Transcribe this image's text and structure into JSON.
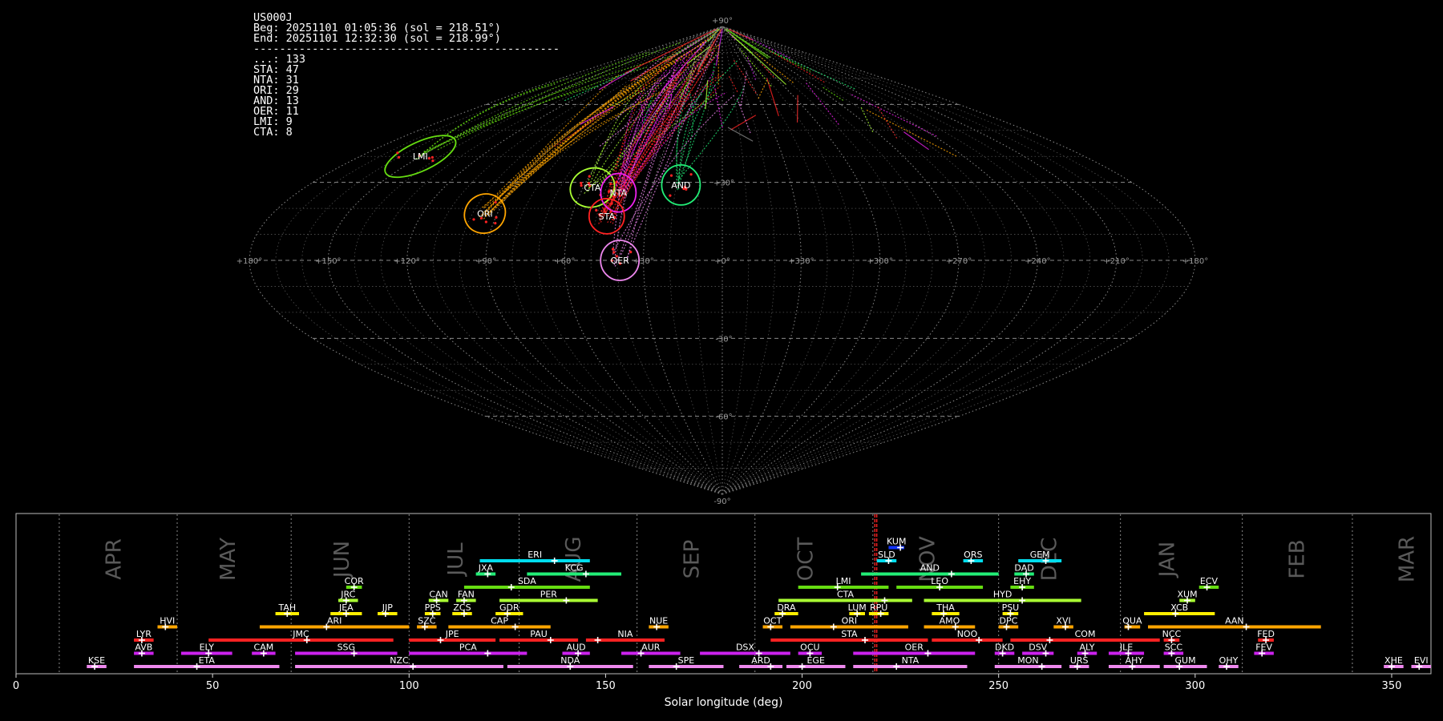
{
  "info": {
    "station": "US000J",
    "beg": "Beg: 20251101 01:05:36 (sol = 218.51°)",
    "end": "End: 20251101 12:32:30 (sol = 218.99°)",
    "separator": "-----------------------------------------------",
    "counts": [
      {
        "label": "...: 133"
      },
      {
        "label": "STA: 47"
      },
      {
        "label": "NTA: 31"
      },
      {
        "label": "ORI: 29"
      },
      {
        "label": "AND: 13"
      },
      {
        "label": "OER: 11"
      },
      {
        "label": "LMI: 9"
      },
      {
        "label": "CTA: 8"
      }
    ]
  },
  "chart_data": [
    {
      "type": "scatter",
      "projection": "sinusoidal",
      "grid": true,
      "lon_labels": [
        {
          "text": "+180°",
          "lon": 180
        },
        {
          "text": "+150°",
          "lon": 150
        },
        {
          "text": "+120°",
          "lon": 120
        },
        {
          "text": "+90°",
          "lon": 90
        },
        {
          "text": "+60°",
          "lon": 60
        },
        {
          "text": "+30°",
          "lon": 30
        },
        {
          "text": "+0°",
          "lon": 0
        },
        {
          "text": "+330°",
          "lon": -30
        },
        {
          "text": "+300°",
          "lon": -60
        },
        {
          "text": "+270°",
          "lon": -90
        },
        {
          "text": "+240°",
          "lon": -120
        },
        {
          "text": "+210°",
          "lon": -150
        },
        {
          "text": "+180°",
          "lon": -180
        }
      ],
      "lat_labels": [
        {
          "text": "+90°",
          "lat": 90
        },
        {
          "text": "+30°",
          "lat": 30
        },
        {
          "text": "-30°",
          "lat": -30
        },
        {
          "text": "-60°",
          "lat": -60
        },
        {
          "text": "-90°",
          "lat": -90
        }
      ],
      "radiants": [
        {
          "name": "LMI",
          "lon": 150,
          "lat": 40,
          "color": "#66dd11",
          "rx": 48,
          "ry": 18,
          "rot": -25
        },
        {
          "name": "ORI",
          "lon": 95,
          "lat": 18,
          "color": "#ffa500",
          "rx": 26,
          "ry": 24,
          "rot": -30
        },
        {
          "name": "CTA",
          "lon": 56,
          "lat": 28,
          "color": "#aaff33",
          "rx": 28,
          "ry": 24,
          "rot": -20
        },
        {
          "name": "NTA",
          "lon": 44,
          "lat": 26,
          "color": "#ee22ee",
          "rx": 22,
          "ry": 24,
          "rot": 0
        },
        {
          "name": "STA",
          "lon": 46,
          "lat": 17,
          "color": "#ff2222",
          "rx": 22,
          "ry": 22,
          "rot": 0
        },
        {
          "name": "AND",
          "lon": 18,
          "lat": 29,
          "color": "#22ee77",
          "rx": 24,
          "ry": 25,
          "rot": 0
        },
        {
          "name": "OER",
          "lon": 39,
          "lat": 0,
          "color": "#ee88ee",
          "rx": 24,
          "ry": 25,
          "rot": 0
        }
      ]
    },
    {
      "type": "bar",
      "orientation": "horizontal-ranges",
      "xlabel": "Solar longitude (deg)",
      "xlim": [
        0,
        360
      ],
      "x_ticks": [
        0,
        50,
        100,
        150,
        200,
        250,
        300,
        350
      ],
      "marker_sol": [
        218.51,
        218.99
      ],
      "months": [
        {
          "name": "APR",
          "at": 25
        },
        {
          "name": "MAY",
          "at": 54
        },
        {
          "name": "JUN",
          "at": 83
        },
        {
          "name": "JUL",
          "at": 112
        },
        {
          "name": "AUG",
          "at": 142
        },
        {
          "name": "SEP",
          "at": 172
        },
        {
          "name": "OCT",
          "at": 201
        },
        {
          "name": "NOV",
          "at": 232
        },
        {
          "name": "DEC",
          "at": 263
        },
        {
          "name": "JAN",
          "at": 293
        },
        {
          "name": "FEB",
          "at": 326
        },
        {
          "name": "MAR",
          "at": 354
        }
      ],
      "month_dividers": [
        11,
        41,
        70,
        100,
        128,
        158,
        188,
        218,
        250,
        281,
        312,
        340
      ],
      "showers": [
        {
          "name": "KUM",
          "start": 222,
          "end": 226,
          "peak": 225,
          "row": 12,
          "color": "#1133ff"
        },
        {
          "name": "ERI",
          "start": 118,
          "end": 146,
          "peak": 137,
          "row": 11,
          "color": "#00ddee"
        },
        {
          "name": "SLD",
          "start": 219,
          "end": 224,
          "peak": 222,
          "row": 11,
          "color": "#00ddee"
        },
        {
          "name": "ORS",
          "start": 241,
          "end": 246,
          "peak": 243,
          "row": 11,
          "color": "#00ddee"
        },
        {
          "name": "GEM",
          "start": 255,
          "end": 266,
          "peak": 262,
          "row": 11,
          "color": "#00ddee"
        },
        {
          "name": "JXA",
          "start": 117,
          "end": 122,
          "peak": 120,
          "row": 10,
          "color": "#22ee77"
        },
        {
          "name": "KCG",
          "start": 130,
          "end": 154,
          "peak": 145,
          "row": 10,
          "color": "#22ee77"
        },
        {
          "name": "AND",
          "start": 215,
          "end": 250,
          "peak": 238,
          "row": 10,
          "color": "#22ee77"
        },
        {
          "name": "DAD",
          "start": 254,
          "end": 259,
          "peak": 257,
          "row": 10,
          "color": "#22ee77"
        },
        {
          "name": "COR",
          "start": 84,
          "end": 88,
          "peak": 86,
          "row": 9,
          "color": "#66dd11"
        },
        {
          "name": "SDA",
          "start": 114,
          "end": 146,
          "peak": 126,
          "row": 9,
          "color": "#66dd11"
        },
        {
          "name": "LMI",
          "start": 199,
          "end": 222,
          "peak": 209,
          "row": 9,
          "color": "#66dd11"
        },
        {
          "name": "LEO",
          "start": 224,
          "end": 246,
          "peak": 235,
          "row": 9,
          "color": "#66dd11"
        },
        {
          "name": "EHY",
          "start": 253,
          "end": 259,
          "peak": 256,
          "row": 9,
          "color": "#66dd11"
        },
        {
          "name": "ECV",
          "start": 301,
          "end": 306,
          "peak": 303,
          "row": 9,
          "color": "#66dd11"
        },
        {
          "name": "JRC",
          "start": 82,
          "end": 87,
          "peak": 84,
          "row": 8,
          "color": "#aaff33"
        },
        {
          "name": "CAN",
          "start": 105,
          "end": 110,
          "peak": 107,
          "row": 8,
          "color": "#aaff33"
        },
        {
          "name": "FAN",
          "start": 112,
          "end": 117,
          "peak": 114,
          "row": 8,
          "color": "#aaff33"
        },
        {
          "name": "PER",
          "start": 123,
          "end": 148,
          "peak": 140,
          "row": 8,
          "color": "#aaff33"
        },
        {
          "name": "CTA",
          "start": 194,
          "end": 228,
          "peak": 221,
          "row": 8,
          "color": "#aaff33"
        },
        {
          "name": "HYD",
          "start": 231,
          "end": 271,
          "peak": 256,
          "row": 8,
          "color": "#aaff33"
        },
        {
          "name": "XUM",
          "start": 296,
          "end": 300,
          "peak": 298,
          "row": 8,
          "color": "#aaff33"
        },
        {
          "name": "TAH",
          "start": 66,
          "end": 72,
          "peak": 69,
          "row": 7,
          "color": "#ffee00"
        },
        {
          "name": "JEA",
          "start": 80,
          "end": 88,
          "peak": 84,
          "row": 7,
          "color": "#ffee00"
        },
        {
          "name": "JIP",
          "start": 92,
          "end": 97,
          "peak": 94,
          "row": 7,
          "color": "#ffee00"
        },
        {
          "name": "PPS",
          "start": 104,
          "end": 108,
          "peak": 106,
          "row": 7,
          "color": "#ffee00"
        },
        {
          "name": "ZCS",
          "start": 111,
          "end": 116,
          "peak": 114,
          "row": 7,
          "color": "#ffee00"
        },
        {
          "name": "GDR",
          "start": 122,
          "end": 129,
          "peak": 125,
          "row": 7,
          "color": "#ffee00"
        },
        {
          "name": "DRA",
          "start": 193,
          "end": 199,
          "peak": 195,
          "row": 7,
          "color": "#ffee00"
        },
        {
          "name": "LUM",
          "start": 212,
          "end": 216,
          "peak": 214,
          "row": 7,
          "color": "#ffee00"
        },
        {
          "name": "RPU",
          "start": 217,
          "end": 222,
          "peak": 220,
          "row": 7,
          "color": "#ffee00"
        },
        {
          "name": "THA",
          "start": 233,
          "end": 240,
          "peak": 236,
          "row": 7,
          "color": "#ffee00"
        },
        {
          "name": "PSU",
          "start": 251,
          "end": 255,
          "peak": 253,
          "row": 7,
          "color": "#ffee00"
        },
        {
          "name": "XCB",
          "start": 287,
          "end": 305,
          "peak": 295,
          "row": 7,
          "color": "#ffee00"
        },
        {
          "name": "HVI",
          "start": 36,
          "end": 41,
          "peak": 38,
          "row": 6,
          "color": "#ffa500"
        },
        {
          "name": "ARI",
          "start": 62,
          "end": 100,
          "peak": 79,
          "row": 6,
          "color": "#ffa500"
        },
        {
          "name": "SZC",
          "start": 102,
          "end": 107,
          "peak": 104,
          "row": 6,
          "color": "#ffa500"
        },
        {
          "name": "CAP",
          "start": 110,
          "end": 136,
          "peak": 127,
          "row": 6,
          "color": "#ffa500"
        },
        {
          "name": "NUE",
          "start": 161,
          "end": 166,
          "peak": 163,
          "row": 6,
          "color": "#ffa500"
        },
        {
          "name": "OCT",
          "start": 190,
          "end": 195,
          "peak": 192,
          "row": 6,
          "color": "#ffa500"
        },
        {
          "name": "ORI",
          "start": 197,
          "end": 227,
          "peak": 208,
          "row": 6,
          "color": "#ffa500"
        },
        {
          "name": "AMO",
          "start": 231,
          "end": 244,
          "peak": 239,
          "row": 6,
          "color": "#ffa500"
        },
        {
          "name": "DPC",
          "start": 250,
          "end": 255,
          "peak": 252,
          "row": 6,
          "color": "#ffa500"
        },
        {
          "name": "XVI",
          "start": 264,
          "end": 269,
          "peak": 267,
          "row": 6,
          "color": "#ffa500"
        },
        {
          "name": "QUA",
          "start": 282,
          "end": 286,
          "peak": 283,
          "row": 6,
          "color": "#ffa500"
        },
        {
          "name": "AAN",
          "start": 288,
          "end": 332,
          "peak": 313,
          "row": 6,
          "color": "#ffa500"
        },
        {
          "name": "LYR",
          "start": 30,
          "end": 35,
          "peak": 32,
          "row": 5,
          "color": "#ff2222"
        },
        {
          "name": "JMC",
          "start": 49,
          "end": 96,
          "peak": 74,
          "row": 5,
          "color": "#ff2222"
        },
        {
          "name": "JPE",
          "start": 100,
          "end": 122,
          "peak": 108,
          "row": 5,
          "color": "#ff2222"
        },
        {
          "name": "PAU",
          "start": 123,
          "end": 143,
          "peak": 136,
          "row": 5,
          "color": "#ff2222"
        },
        {
          "name": "NIA",
          "start": 145,
          "end": 165,
          "peak": 148,
          "row": 5,
          "color": "#ff2222"
        },
        {
          "name": "STA",
          "start": 192,
          "end": 232,
          "peak": 216,
          "row": 5,
          "color": "#ff2222"
        },
        {
          "name": "NOO",
          "start": 233,
          "end": 251,
          "peak": 245,
          "row": 5,
          "color": "#ff2222"
        },
        {
          "name": "COM",
          "start": 253,
          "end": 291,
          "peak": 263,
          "row": 5,
          "color": "#ff2222"
        },
        {
          "name": "NCC",
          "start": 292,
          "end": 296,
          "peak": 294,
          "row": 5,
          "color": "#ff2222"
        },
        {
          "name": "FED",
          "start": 316,
          "end": 320,
          "peak": 318,
          "row": 5,
          "color": "#ff2222"
        },
        {
          "name": "AVB",
          "start": 30,
          "end": 35,
          "peak": 32,
          "row": 4,
          "color": "#cc22ee"
        },
        {
          "name": "ELY",
          "start": 42,
          "end": 55,
          "peak": 49,
          "row": 4,
          "color": "#cc22ee"
        },
        {
          "name": "CAM",
          "start": 60,
          "end": 66,
          "peak": 63,
          "row": 4,
          "color": "#cc22ee"
        },
        {
          "name": "SSG",
          "start": 71,
          "end": 97,
          "peak": 86,
          "row": 4,
          "color": "#cc22ee"
        },
        {
          "name": "PCA",
          "start": 100,
          "end": 130,
          "peak": 120,
          "row": 4,
          "color": "#cc22ee"
        },
        {
          "name": "AUD",
          "start": 139,
          "end": 146,
          "peak": 143,
          "row": 4,
          "color": "#cc22ee"
        },
        {
          "name": "AUR",
          "start": 154,
          "end": 169,
          "peak": 159,
          "row": 4,
          "color": "#cc22ee"
        },
        {
          "name": "DSX",
          "start": 174,
          "end": 197,
          "peak": 189,
          "row": 4,
          "color": "#cc22ee"
        },
        {
          "name": "OCU",
          "start": 199,
          "end": 205,
          "peak": 202,
          "row": 4,
          "color": "#cc22ee"
        },
        {
          "name": "OER",
          "start": 213,
          "end": 244,
          "peak": 232,
          "row": 4,
          "color": "#cc22ee"
        },
        {
          "name": "DKD",
          "start": 249,
          "end": 254,
          "peak": 251,
          "row": 4,
          "color": "#cc22ee"
        },
        {
          "name": "DSV",
          "start": 256,
          "end": 264,
          "peak": 262,
          "row": 4,
          "color": "#cc22ee"
        },
        {
          "name": "ALY",
          "start": 270,
          "end": 275,
          "peak": 272,
          "row": 4,
          "color": "#cc22ee"
        },
        {
          "name": "JLE",
          "start": 278,
          "end": 287,
          "peak": 283,
          "row": 4,
          "color": "#cc22ee"
        },
        {
          "name": "SCC",
          "start": 292,
          "end": 297,
          "peak": 294,
          "row": 4,
          "color": "#cc22ee"
        },
        {
          "name": "FEV",
          "start": 315,
          "end": 320,
          "peak": 317,
          "row": 4,
          "color": "#cc22ee"
        },
        {
          "name": "KSE",
          "start": 18,
          "end": 23,
          "peak": 20,
          "row": 3,
          "color": "#ee88ee"
        },
        {
          "name": "ETA",
          "start": 30,
          "end": 67,
          "peak": 46,
          "row": 3,
          "color": "#ee88ee"
        },
        {
          "name": "NZC",
          "start": 71,
          "end": 124,
          "peak": 101,
          "row": 3,
          "color": "#ee88ee"
        },
        {
          "name": "NDA",
          "start": 125,
          "end": 157,
          "peak": 141,
          "row": 3,
          "color": "#ee88ee"
        },
        {
          "name": "SPE",
          "start": 161,
          "end": 180,
          "peak": 168,
          "row": 3,
          "color": "#ee88ee"
        },
        {
          "name": "ARD",
          "start": 184,
          "end": 195,
          "peak": 192,
          "row": 3,
          "color": "#ee88ee"
        },
        {
          "name": "EGE",
          "start": 196,
          "end": 211,
          "peak": 200,
          "row": 3,
          "color": "#ee88ee"
        },
        {
          "name": "NTA",
          "start": 213,
          "end": 242,
          "peak": 224,
          "row": 3,
          "color": "#ee88ee"
        },
        {
          "name": "MON",
          "start": 249,
          "end": 266,
          "peak": 261,
          "row": 3,
          "color": "#ee88ee"
        },
        {
          "name": "URS",
          "start": 268,
          "end": 273,
          "peak": 270,
          "row": 3,
          "color": "#ee88ee"
        },
        {
          "name": "AHY",
          "start": 278,
          "end": 291,
          "peak": 284,
          "row": 3,
          "color": "#ee88ee"
        },
        {
          "name": "GUM",
          "start": 292,
          "end": 303,
          "peak": 296,
          "row": 3,
          "color": "#ee88ee"
        },
        {
          "name": "OHY",
          "start": 306,
          "end": 311,
          "peak": 308,
          "row": 3,
          "color": "#ee88ee"
        },
        {
          "name": "XHE",
          "start": 348,
          "end": 353,
          "peak": 350,
          "row": 3,
          "color": "#ee88ee"
        },
        {
          "name": "EVI",
          "start": 355,
          "end": 360,
          "peak": 357,
          "row": 3,
          "color": "#ee88ee"
        }
      ]
    }
  ]
}
